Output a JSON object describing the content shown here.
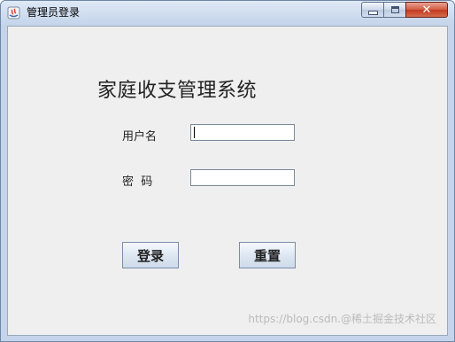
{
  "window": {
    "title": "管理员登录",
    "close_glyph": "✕"
  },
  "form": {
    "heading": "家庭收支管理系统",
    "username_label": "用户名",
    "username_value": "",
    "password_label": "密  码",
    "password_value": "",
    "login_button": "登录",
    "reset_button": "重置"
  },
  "watermark": "https://blog.csdn.@稀土掘金技术社区"
}
